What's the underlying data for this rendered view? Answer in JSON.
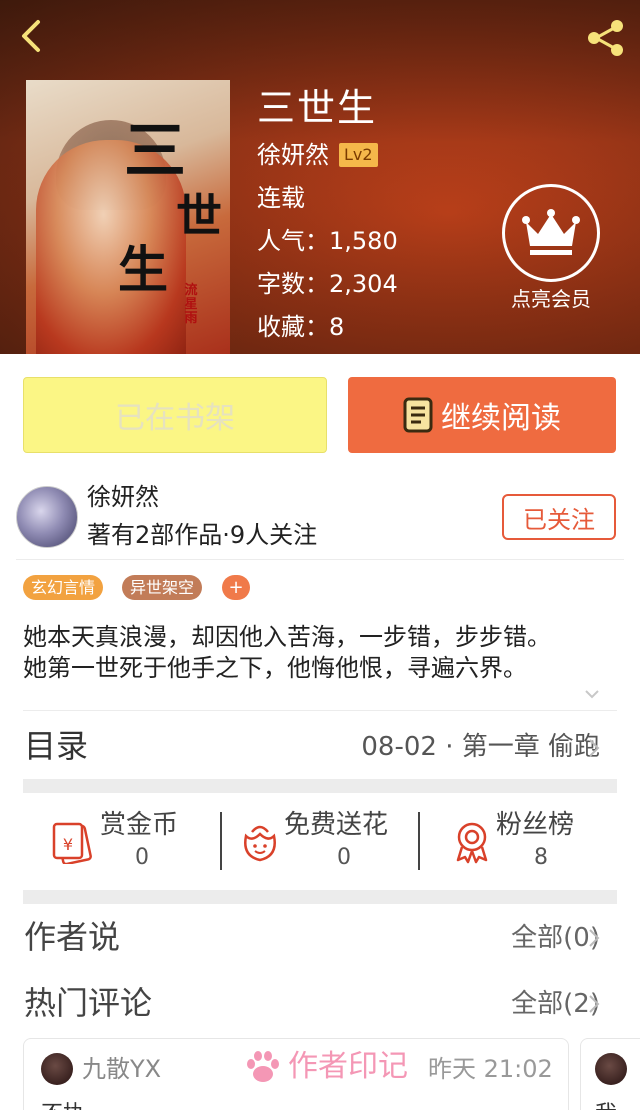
{
  "book": {
    "title": "三世生",
    "author": "徐妍然",
    "level": "Lv2",
    "status": "连载",
    "popularity_label": "人气：",
    "popularity": "1,580",
    "wordcount_label": "字数：",
    "wordcount": "2,304",
    "favorites_label": "收藏：",
    "favorites": "8",
    "cover_title_chars": [
      "三",
      "世",
      "生"
    ],
    "cover_seal": "流星雨"
  },
  "vip": {
    "label": "点亮会员"
  },
  "actions": {
    "shelf_label": "已在书架",
    "read_label": "继续阅读"
  },
  "author": {
    "name": "徐妍然",
    "meta": "著有2部作品·9人关注",
    "follow_label": "已关注"
  },
  "tags": [
    "玄幻言情",
    "异世架空"
  ],
  "tag_add": "+",
  "intro": [
    "她本天真浪漫，却因他入苦海，一步错，步步错。",
    "她第一世死于他手之下，他悔他恨，寻遍六界。"
  ],
  "toc": {
    "title": "目录",
    "latest": "08-02 · 第一章 偷跑"
  },
  "stats": [
    {
      "label": "赏金币",
      "value": "0",
      "icon": "red-envelope-icon"
    },
    {
      "label": "免费送花",
      "value": "0",
      "icon": "flower-icon"
    },
    {
      "label": "粉丝榜",
      "value": "8",
      "icon": "badge-ribbon-icon"
    }
  ],
  "author_says": {
    "title": "作者说",
    "more": "全部(0)"
  },
  "hot_comments": {
    "title": "热门评论",
    "more": "全部(2)"
  },
  "comment": {
    "user": "九散YX",
    "mark": "作者印记",
    "time": "昨天 21:02",
    "body": "不执",
    "body2": "我"
  },
  "colors": {
    "accent": "#ef6b40",
    "shelf": "#fbf685",
    "tag1": "#f2a240",
    "tag2": "#c27c58",
    "mark": "#f497b5"
  }
}
